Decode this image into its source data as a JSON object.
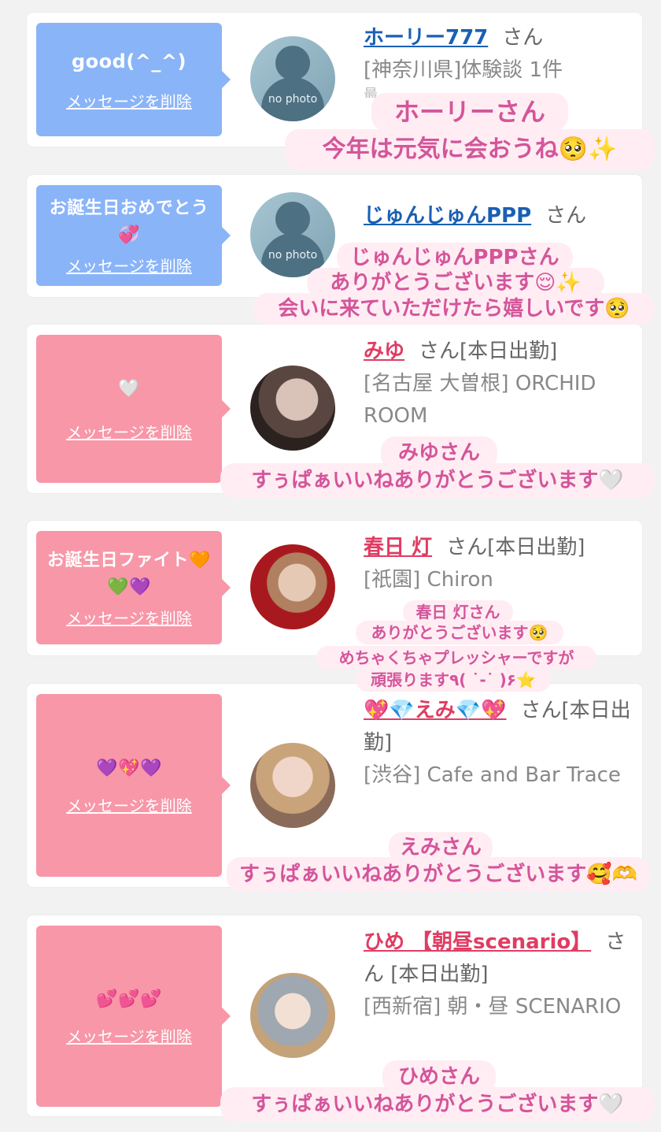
{
  "cards": [
    {
      "bubble": "good(^_^)",
      "delete": "メッセージを削除",
      "name": "ホーリー777",
      "san": "さん",
      "line1": "[神奈川県]体験談 1件",
      "line2": "最",
      "avatar": "no photo",
      "overlay": [
        "ホーリーさん",
        "今年は元気に会おうね🥺✨"
      ]
    },
    {
      "bubble": "お誕生日おめでとう💞",
      "delete": "メッセージを削除",
      "name": "じゅんじゅんPPP",
      "san": "さん",
      "avatar": "no photo",
      "overlay": [
        "じゅんじゅんPPPさん",
        "ありがとうございます😌✨",
        "会いに来ていただけたら嬉しいです🥺"
      ]
    },
    {
      "bubble": "🤍",
      "delete": "メッセージを削除",
      "name": "みゆ",
      "san": "さん[本日出勤]",
      "line1": "[名古屋 大曽根] ORCHID ROOM",
      "overlay": [
        "みゆさん",
        "すぅぱぁいいねありがとうございます🤍"
      ]
    },
    {
      "bubble": "お誕生日ファイト🧡💚💜",
      "delete": "メッセージを削除",
      "name": "春日 灯",
      "san": "さん[本日出勤]",
      "line1": "[祇園] Chiron",
      "overlay": [
        "春日 灯さん",
        "ありがとうございます🥺",
        "めちゃくちゃプレッシャーですが",
        "頑張ります٩( ˙-˙ )۶⭐️"
      ]
    },
    {
      "bubble": "💜💖💜",
      "delete": "メッセージを削除",
      "name": "💖💎えみ💎💖",
      "san": "さん[本日出勤]",
      "line1": "[渋谷] Cafe and Bar Trace",
      "overlay": [
        "えみさん",
        "すぅぱぁいいねありがとうございます🥰🫶"
      ]
    },
    {
      "bubble": "💕💕💕",
      "delete": "メッセージを削除",
      "name": "ひめ 【朝昼scenario】",
      "san": "さん [本日出勤]",
      "line1": "[西新宿] 朝・昼 SCENARIO",
      "overlay": [
        "ひめさん",
        "すぅぱぁいいねありがとうございます🤍"
      ]
    }
  ],
  "colors": {
    "blue_bubble": "#8ab4f8",
    "pink_bubble": "#f797a8",
    "name_blue": "#1a5fb4",
    "name_pink": "#e03c63",
    "overlay_text": "#d4559a"
  }
}
